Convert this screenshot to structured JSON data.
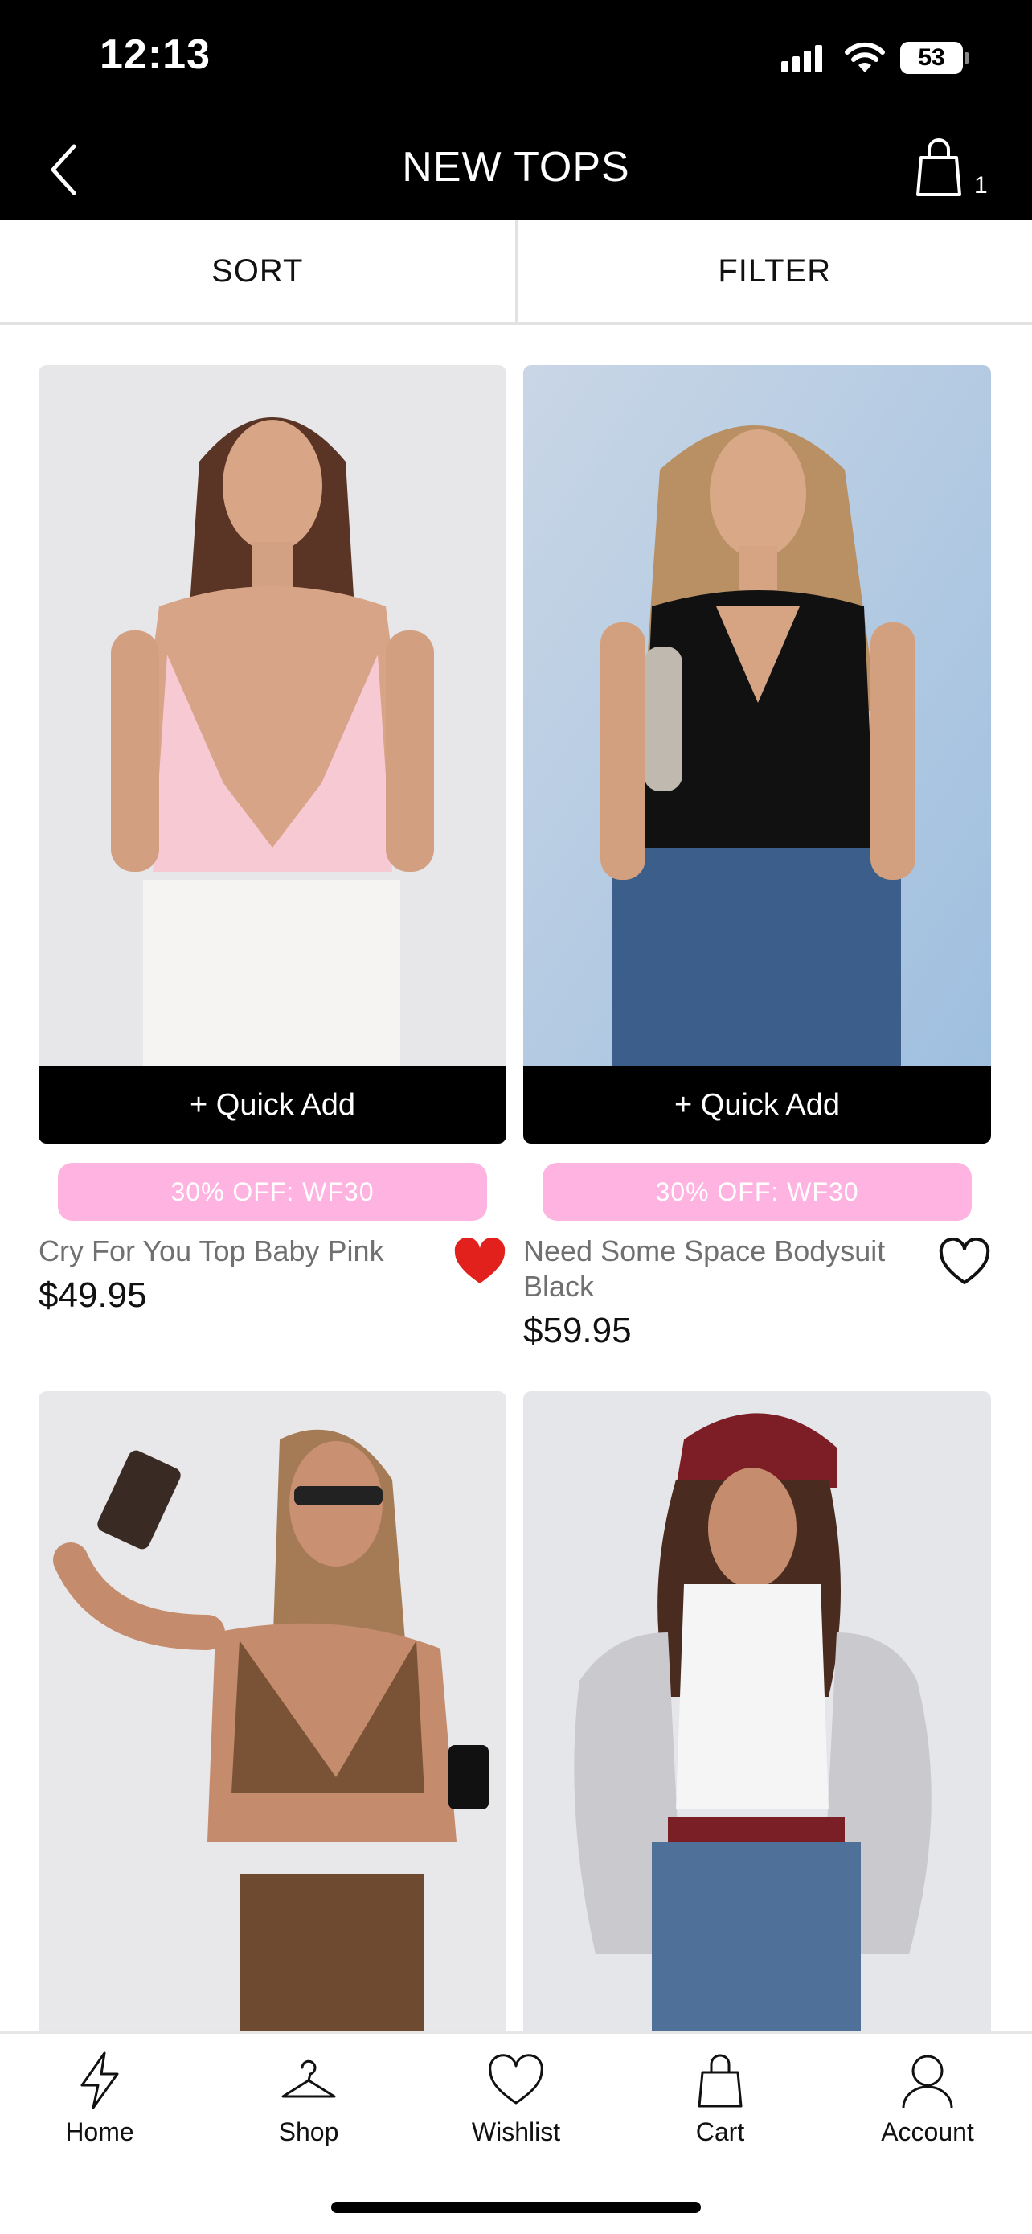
{
  "status_bar": {
    "time": "12:13",
    "battery": "53"
  },
  "header": {
    "title": "NEW TOPS",
    "cart_count": "1"
  },
  "toolbar": {
    "sort_label": "SORT",
    "filter_label": "FILTER"
  },
  "products": [
    {
      "name": "Cry For You Top Baby Pink",
      "price": "$49.95",
      "quick_add": "+ Quick Add",
      "promo": "30% OFF: WF30",
      "wishlisted": true
    },
    {
      "name": "Need Some Space Bodysuit Black",
      "price": "$59.95",
      "quick_add": "+ Quick Add",
      "promo": "30% OFF: WF30",
      "wishlisted": false
    },
    {
      "name": "",
      "price": ""
    },
    {
      "name": "",
      "price": ""
    }
  ],
  "tabs": [
    {
      "label": "Home",
      "icon": "lightning-icon"
    },
    {
      "label": "Shop",
      "icon": "hanger-icon"
    },
    {
      "label": "Wishlist",
      "icon": "heart-icon"
    },
    {
      "label": "Cart",
      "icon": "bag-icon"
    },
    {
      "label": "Account",
      "icon": "user-icon"
    }
  ],
  "colors": {
    "promo_pink": "#ffb3e0",
    "heart_red": "#e3211c",
    "header_bg": "#000000"
  }
}
